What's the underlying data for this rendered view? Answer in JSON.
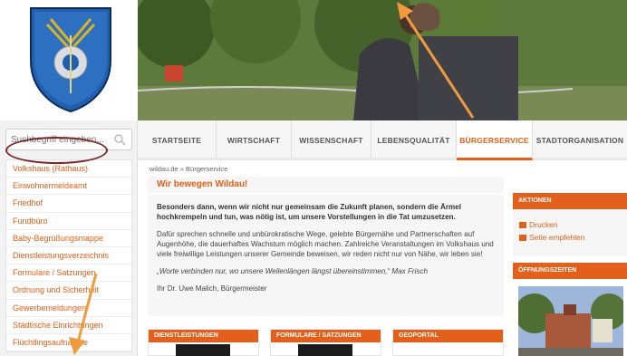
{
  "logo": {
    "alt": "Wappen"
  },
  "search": {
    "placeholder": "Suchbegriff eingeben..."
  },
  "sidebar": {
    "items": [
      {
        "label": "Volkshaus (Rathaus)"
      },
      {
        "label": "Einwohnermeldeamt"
      },
      {
        "label": "Friedhof"
      },
      {
        "label": "Fundbüro"
      },
      {
        "label": "Baby-Begrüßungsmappe"
      },
      {
        "label": "Dienstleistungsverzeichnis"
      },
      {
        "label": "Formulare / Satzungen"
      },
      {
        "label": "Ordnung und Sicherheit"
      },
      {
        "label": "Gewerbemeldungen"
      },
      {
        "label": "Städtische Einrichtungen"
      },
      {
        "label": "Flüchtlingsaufnahme"
      }
    ]
  },
  "nav": {
    "tabs": [
      {
        "label": "STARTSEITE"
      },
      {
        "label": "WIRTSCHAFT"
      },
      {
        "label": "WISSENSCHAFT"
      },
      {
        "label": "LEBENSQUALITÄT"
      },
      {
        "label": "BÜRGERSERVICE",
        "active": true
      },
      {
        "label": "STADTORGANISATION"
      }
    ]
  },
  "breadcrumb": "wildau.de » Bürgerservice",
  "page": {
    "title": "Wir bewegen Wildau!",
    "lead": "Besonders dann, wenn wir nicht nur gemeinsam die Zukunft planen, sondern die Ärmel hochkrempeln und tun, was nötig ist, um unsere Vorstellungen in die Tat umzusetzen.",
    "body": "Dafür sprechen schnelle und unbürokratische Wege, gelebte Bürgernähe und Partnerschaften auf Augenhöhe, die dauerhaftes Wachstum möglich machen. Zahlreiche Veranstaltungen im Volkshaus und viele freiwillige Leistungen unserer Gemeinde beweisen, wir reden nicht nur von Nähe, wir leben sie!",
    "quote": "„Worte verbinden nur, wo unsere Wellenlängen längst übereinstimmen,“ Max Frisch",
    "signature": "Ihr Dr. Uwe Malich, Bürgermeister"
  },
  "boxes": [
    {
      "title": "DIENSTLEISTUNGEN"
    },
    {
      "title": "FORMULARE / SATZUNGEN"
    },
    {
      "title": "GEOPORTAL"
    }
  ],
  "right": {
    "actions_title": "AKTIONEN",
    "actions": [
      {
        "label": "Drucken"
      },
      {
        "label": "Seite empfehlen"
      }
    ],
    "hours_title": "ÖFFNUNGSZEITEN"
  },
  "colors": {
    "accent": "#e2601b",
    "annotation_circle": "#7a2626"
  }
}
